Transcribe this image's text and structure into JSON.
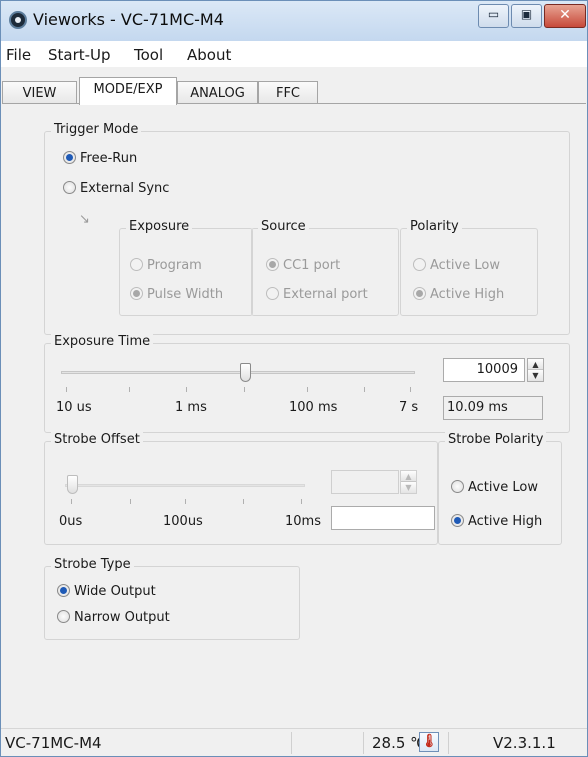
{
  "window": {
    "title": "Vieworks - VC-71MC-M4",
    "min_glyph": "▭",
    "max_glyph": "▣",
    "close_glyph": "✕"
  },
  "menu": {
    "items": [
      "File",
      "Start-Up",
      "Tool",
      "About"
    ]
  },
  "tabs": [
    {
      "label": "VIEW",
      "active": false
    },
    {
      "label": "MODE/EXP",
      "active": true
    },
    {
      "label": "ANALOG",
      "active": false
    },
    {
      "label": "FFC",
      "active": false
    }
  ],
  "trigger_mode": {
    "label": "Trigger Mode",
    "free_run": "Free-Run",
    "external_sync": "External Sync",
    "selected": "Free-Run",
    "arrow": "↘",
    "exposure": {
      "label": "Exposure",
      "options": [
        "Program",
        "Pulse Width"
      ],
      "selected": "Pulse Width"
    },
    "source": {
      "label": "Source",
      "options": [
        "CC1 port",
        "External port"
      ],
      "selected": "CC1 port"
    },
    "polarity": {
      "label": "Polarity",
      "options": [
        "Active Low",
        "Active High"
      ],
      "selected": "Active High"
    }
  },
  "exposure_time": {
    "label": "Exposure Time",
    "ticks": [
      "10 us",
      "1 ms",
      "100 ms",
      "7 s"
    ],
    "value": "10009",
    "readout": "10.09 ms",
    "slider_fraction": 0.52
  },
  "strobe_offset": {
    "label": "Strobe Offset",
    "ticks": [
      "0us",
      "100us",
      "10ms"
    ],
    "value": "",
    "readout": "",
    "slider_fraction": 0.0
  },
  "strobe_polarity": {
    "label": "Strobe Polarity",
    "options": [
      "Active Low",
      "Active High"
    ],
    "selected": "Active High"
  },
  "strobe_type": {
    "label": "Strobe Type",
    "options": [
      "Wide Output",
      "Narrow Output"
    ],
    "selected": "Wide Output"
  },
  "status": {
    "model": "VC-71MC-M4",
    "temperature": "28.5 ℃",
    "temp_icon": "thermometer-icon",
    "temp_glyph": "🌡",
    "version": "V2.3.1.1"
  },
  "colors": {
    "accent": "#1f5ab6",
    "close_button": "#c7493a"
  }
}
